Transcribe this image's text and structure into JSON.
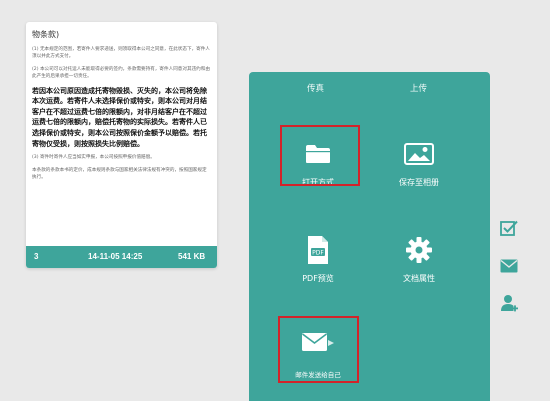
{
  "document": {
    "heading": "物条款)",
    "para1": "(1) 无本规定的范围，若寄件人要求递送，则须取得本公司之同意，在此状态下，寄件人须以并此方式支付。",
    "para2": "(2) 本公司可以对托运人未能取得必要的签约，条款需要持有，寄件人同意对其违约和由此产生的后果承担一切责任。",
    "bold_text": "若因本公司原因造成托寄物毁损、灭失的，本公司将免除本次运费。若寄件人未选择保价或特安，则本公司对月结客户在不超过运费七倍的限额内，对非月结客户在不超过运费七倍的限额内，赔偿托寄物的实际损失。若寄件人已选择保价或特安，则本公司按照保价金额予以赔偿。若托寄物仅受损，则按照损失比例赔偿。",
    "para3": "(3) 寄件时寄件人应当如实申报，本公司按照申报价值赔偿。",
    "para4": "本条款的条款本书的定价，成本规则条款与国家相关法律法规有冲突的，按照国家规定执行。",
    "footer_page": "3",
    "footer_date": "14-11-05 14:25",
    "footer_size": "541 KB"
  },
  "menu": {
    "tabs": [
      "传真",
      "上传"
    ],
    "items": [
      {
        "label": "打开方式",
        "icon": "folder-icon"
      },
      {
        "label": "保存至相册",
        "icon": "image-icon"
      },
      {
        "label": "PDF预览",
        "icon": "pdf-file-icon"
      },
      {
        "label": "文档属性",
        "icon": "gear-icon"
      },
      {
        "label": "邮件发送给自己",
        "icon": "mail-icon"
      }
    ]
  },
  "side_icons": [
    "checkbox-icon",
    "mail-icon",
    "user-add-icon"
  ],
  "colors": {
    "accent": "#3ea59b",
    "highlight": "#d3232a",
    "background": "#e9e9e9"
  }
}
